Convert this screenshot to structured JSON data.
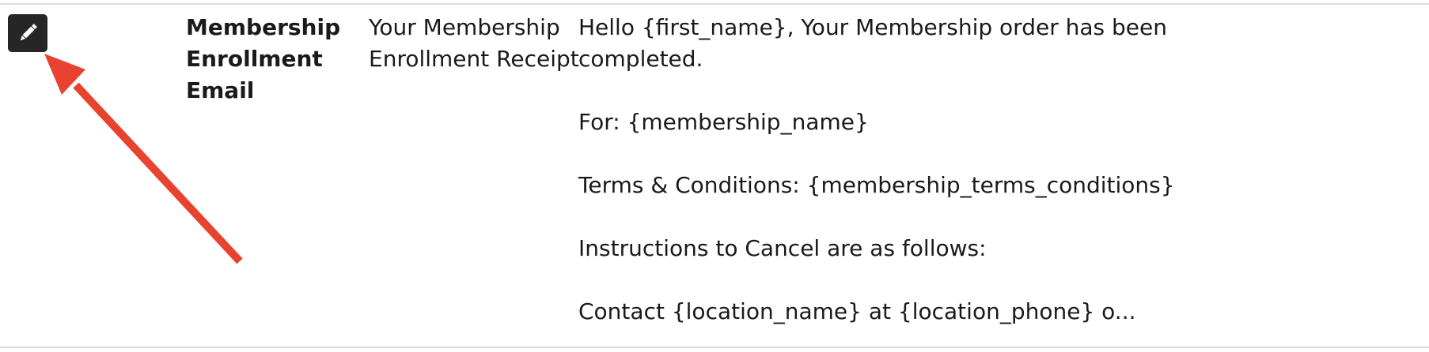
{
  "row": {
    "name_lines": [
      "Membership",
      "Enrollment",
      "Email"
    ],
    "subject_lines": [
      "Your Membership",
      "Enrollment Receipt"
    ],
    "body": {
      "line1": "Hello {first_name}, Your Membership order has been",
      "line2": "completed.",
      "line3": "For: {membership_name}",
      "line4": "Terms & Conditions: {membership_terms_conditions}",
      "line5": "Instructions to Cancel are as follows:",
      "line6": "Contact {location_name} at {location_phone} o..."
    }
  },
  "icons": {
    "edit": "pencil-icon"
  },
  "colors": {
    "edit_button_bg": "#262626",
    "annotation_arrow": "#e8432e",
    "row_border": "#dcdcdc"
  }
}
